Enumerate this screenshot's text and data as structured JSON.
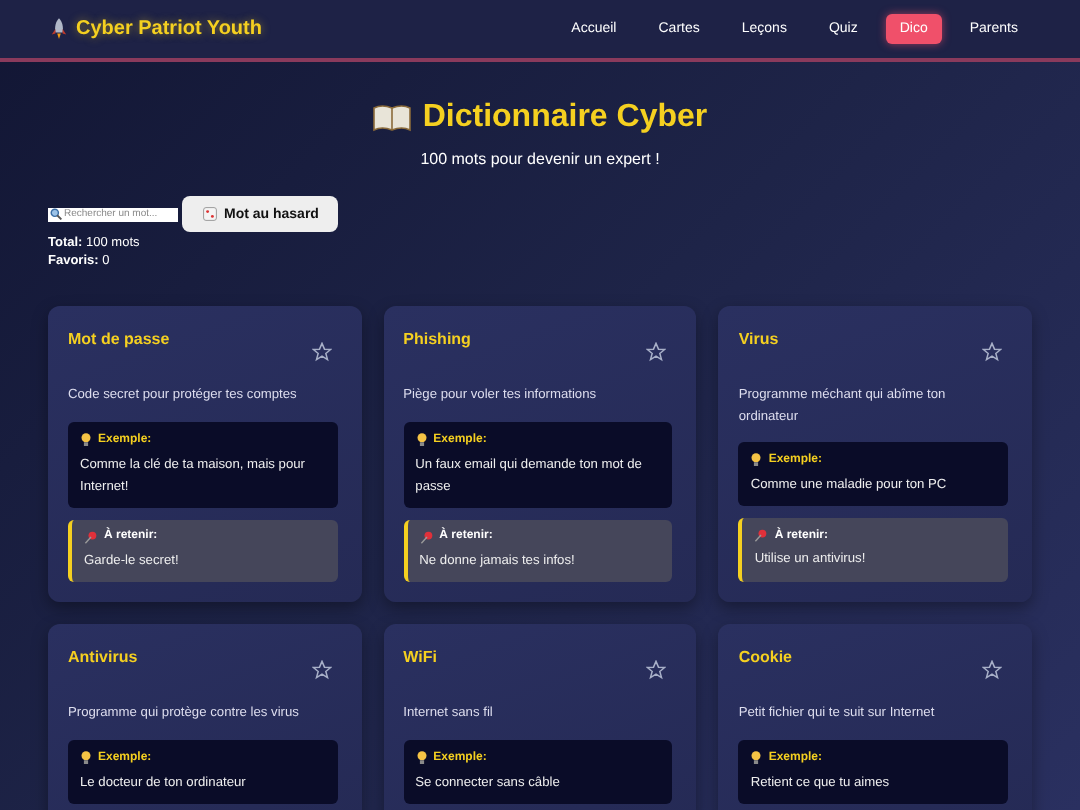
{
  "header": {
    "brand": "Cyber Patriot Youth",
    "nav": [
      {
        "label": "Accueil",
        "selected": false
      },
      {
        "label": "Cartes",
        "selected": false
      },
      {
        "label": "Leçons",
        "selected": false
      },
      {
        "label": "Quiz",
        "selected": false
      },
      {
        "label": "Dico",
        "selected": true
      },
      {
        "label": "Parents",
        "selected": false
      }
    ]
  },
  "title": "Dictionnaire Cyber",
  "subtitle": "100 mots pour devenir un expert !",
  "search": {
    "placeholder": "Rechercher un mot..."
  },
  "random_button": "Mot au hasard",
  "stats": [
    {
      "label": "Total:",
      "value": "100 mots"
    },
    {
      "label": "Favoris:",
      "value": "0"
    }
  ],
  "cards": [
    {
      "term": "Mot de passe",
      "favorite": false,
      "definition": "Code secret pour protéger tes comptes",
      "example_label": "Exemple:",
      "example": "Comme la clé de ta maison, mais pour Internet!",
      "remember_label": "À retenir:",
      "remember": "Garde-le secret!"
    },
    {
      "term": "Phishing",
      "favorite": false,
      "definition": "Piège pour voler tes informations",
      "example_label": "Exemple:",
      "example": "Un faux email qui demande ton mot de passe",
      "remember_label": "À retenir:",
      "remember": "Ne donne jamais tes infos!"
    },
    {
      "term": "Virus",
      "favorite": false,
      "definition": "Programme méchant qui abîme ton ordinateur",
      "example_label": "Exemple:",
      "example": "Comme une maladie pour ton PC",
      "remember_label": "À retenir:",
      "remember": "Utilise un antivirus!"
    },
    {
      "term": "Antivirus",
      "favorite": false,
      "definition": "Programme qui protège contre les virus",
      "example_label": "Exemple:",
      "example": "Le docteur de ton ordinateur"
    },
    {
      "term": "WiFi",
      "favorite": false,
      "definition": "Internet sans fil",
      "example_label": "Exemple:",
      "example": "Se connecter sans câble"
    },
    {
      "term": "Cookie",
      "favorite": false,
      "definition": "Petit fichier qui te suit sur Internet",
      "example_label": "Exemple:",
      "example": "Retient ce que tu aimes"
    }
  ]
}
